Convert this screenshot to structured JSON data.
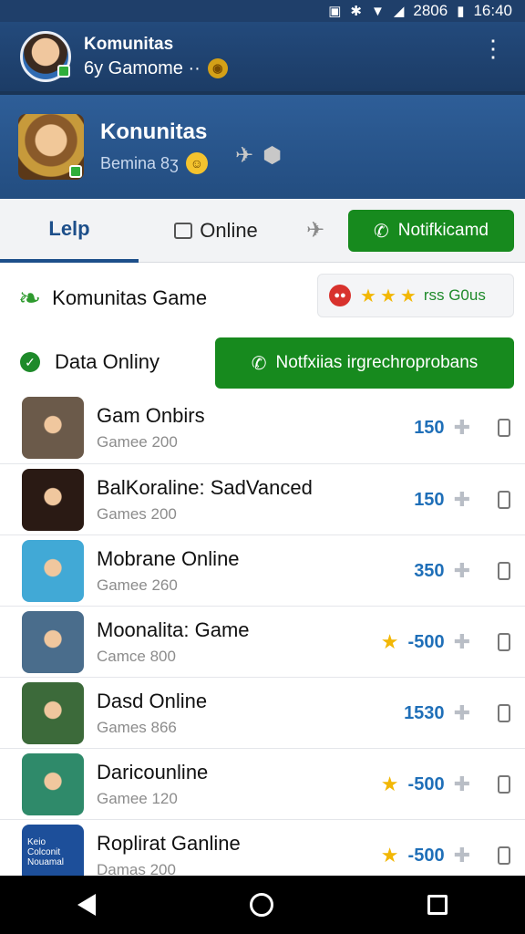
{
  "status": {
    "network": "2806",
    "time": "16:40"
  },
  "appbar": {
    "title": "Komunitas",
    "subtitle": "6y Gamome ··"
  },
  "profile": {
    "title": "Konunitas",
    "subtitle": "Bemina 8ʒ"
  },
  "tabs": [
    {
      "label": "Lelp"
    },
    {
      "label": "Online"
    }
  ],
  "notif_button": {
    "label": "Notifkicamd"
  },
  "section1": {
    "title": "Komunitas Game",
    "rating_text": "rss G0us",
    "stars": 3
  },
  "section2": {
    "title": "Data Onliny",
    "button_label": "Notfxiias irgrechroprobans"
  },
  "games": [
    {
      "title": "Gam Onbirs",
      "subtitle": "Gamee 200",
      "value": "150",
      "starred": false,
      "thumb_color": "#6b5a4a"
    },
    {
      "title": "BalKoraline: SadVanced",
      "subtitle": "Games 200",
      "value": "150",
      "starred": false,
      "thumb_color": "#2a1a14"
    },
    {
      "title": "Mobrane Online",
      "subtitle": "Gamee 260",
      "value": "350",
      "starred": false,
      "thumb_color": "#41a9d6"
    },
    {
      "title": "Moonalita: Game",
      "subtitle": "Camce 800",
      "value": "-500",
      "starred": true,
      "thumb_color": "#4a6d8c"
    },
    {
      "title": "Dasd Online",
      "subtitle": "Games 866",
      "value": "1530",
      "starred": false,
      "thumb_color": "#3c6a3a"
    },
    {
      "title": "Daricounline",
      "subtitle": "Gamee 120",
      "value": "-500",
      "starred": true,
      "thumb_color": "#2f8a6a"
    },
    {
      "title": "Roplirat Ganline",
      "subtitle": "Damas 200",
      "value": "-500",
      "starred": true,
      "thumb_color": "#1d4f9a",
      "thumb_text": "Keio Colconit Nouamal"
    }
  ],
  "colors": {
    "accent_green": "#178a1e",
    "header_blue": "#234a7c",
    "value_blue": "#1f6fb8",
    "star_yellow": "#f2b705"
  }
}
